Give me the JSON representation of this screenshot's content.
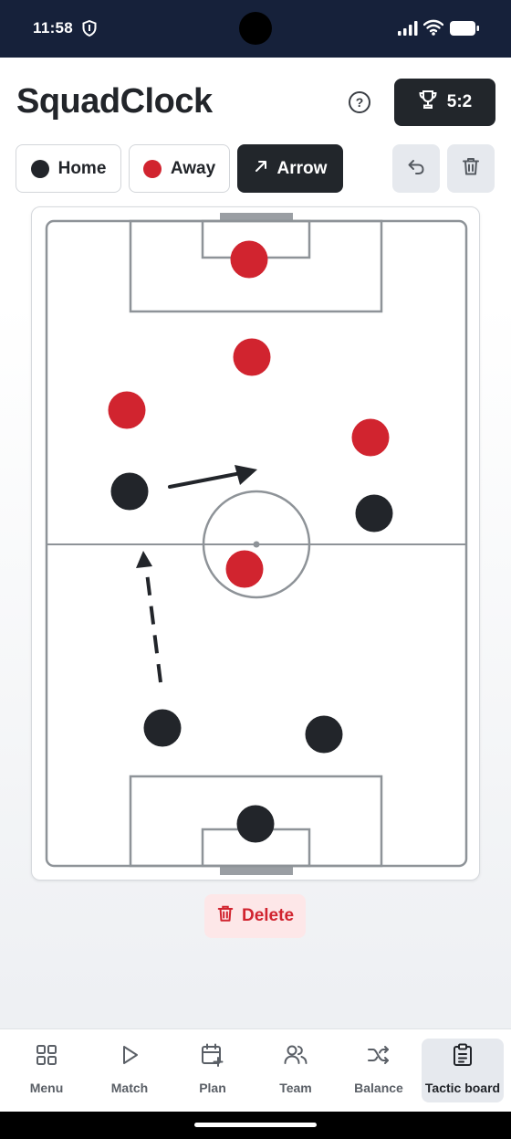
{
  "status_bar": {
    "time": "11:58",
    "icons": [
      "shield-icon",
      "signal-icon",
      "wifi-icon",
      "battery-icon"
    ]
  },
  "header": {
    "title": "SquadClock",
    "help_icon": "question-icon",
    "score": "5:2",
    "score_icon": "trophy-icon"
  },
  "toolbar": {
    "home_label": "Home",
    "away_label": "Away",
    "arrow_label": "Arrow",
    "active_tool": "Arrow",
    "undo_icon": "undo-icon",
    "clear_icon": "trash-icon"
  },
  "colors": {
    "home": "#22252a",
    "away": "#d1242f",
    "pitch_lines": "#8e9398",
    "accent_dark": "#22262b"
  },
  "board": {
    "home_players": [
      {
        "name": "home-player-1"
      },
      {
        "name": "home-player-2"
      },
      {
        "name": "home-player-3"
      },
      {
        "name": "home-player-4"
      },
      {
        "name": "home-goalkeeper"
      }
    ],
    "away_players": [
      {
        "name": "away-goalkeeper"
      },
      {
        "name": "away-player-1"
      },
      {
        "name": "away-player-2"
      },
      {
        "name": "away-player-3"
      },
      {
        "name": "away-player-4"
      }
    ],
    "arrows": [
      {
        "name": "solid-arrow",
        "style": "solid"
      },
      {
        "name": "dashed-arrow",
        "style": "dashed"
      }
    ]
  },
  "delete_label": "Delete",
  "nav": {
    "items": [
      {
        "label": "Menu",
        "icon": "grid-icon"
      },
      {
        "label": "Match",
        "icon": "play-icon"
      },
      {
        "label": "Plan",
        "icon": "calendar-plus-icon"
      },
      {
        "label": "Team",
        "icon": "users-icon"
      },
      {
        "label": "Balance",
        "icon": "shuffle-icon"
      },
      {
        "label": "Tactic board",
        "icon": "clipboard-icon"
      }
    ],
    "active": "Tactic board"
  }
}
